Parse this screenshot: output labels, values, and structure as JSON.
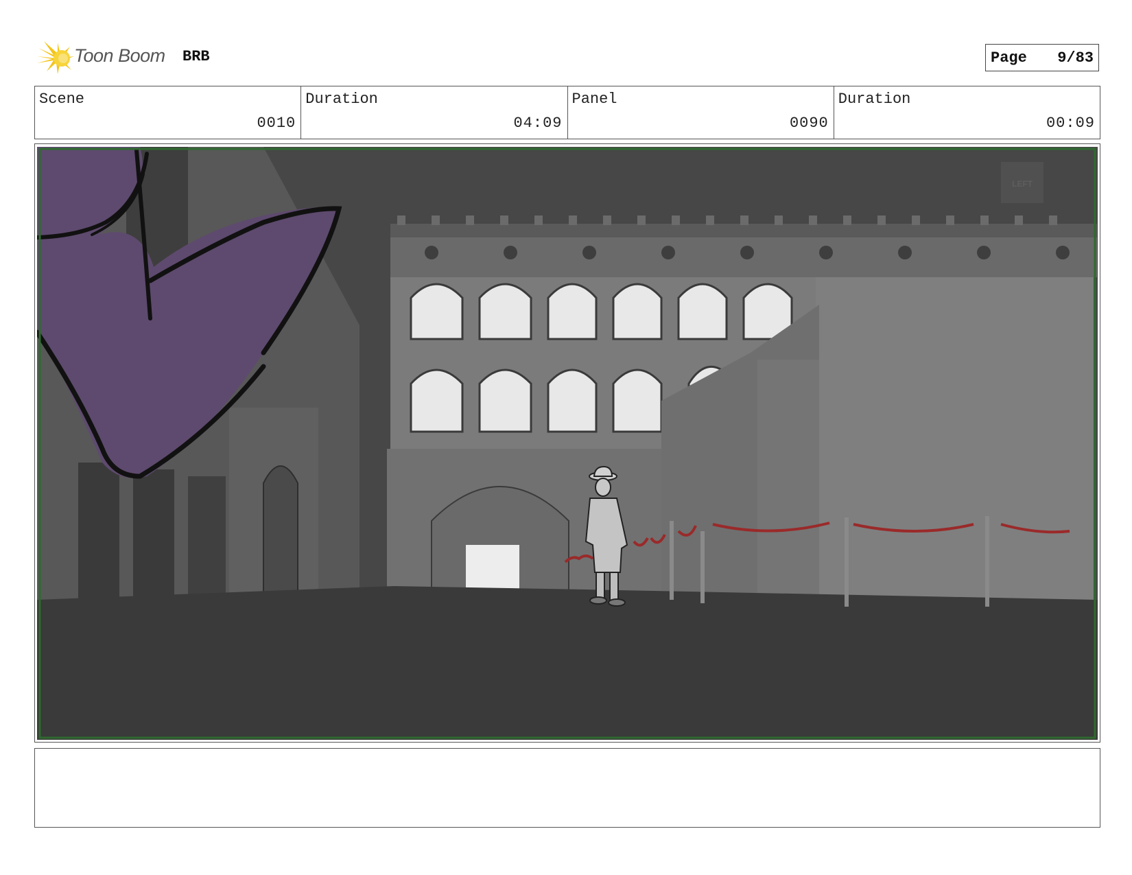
{
  "header": {
    "logo_text": "Toon Boom",
    "project": "BRB",
    "page_label": "Page",
    "page_number": "9/83"
  },
  "info": {
    "scene_label": "Scene",
    "scene_value": "0010",
    "scene_duration_label": "Duration",
    "scene_duration_value": "04:09",
    "panel_label": "Panel",
    "panel_value": "0090",
    "panel_duration_label": "Duration",
    "panel_duration_value": "00:09"
  },
  "panel": {
    "wall_sign": "LEFT",
    "colors": {
      "sky": "#474747",
      "ground": "#3a3a3a",
      "building": "#7d7d7d",
      "window": "#e8e8e8",
      "cape": "#5e4a6e",
      "rope": "#9a2a2a",
      "frame": "#2f6a2f"
    }
  },
  "notes": {
    "text": ""
  }
}
